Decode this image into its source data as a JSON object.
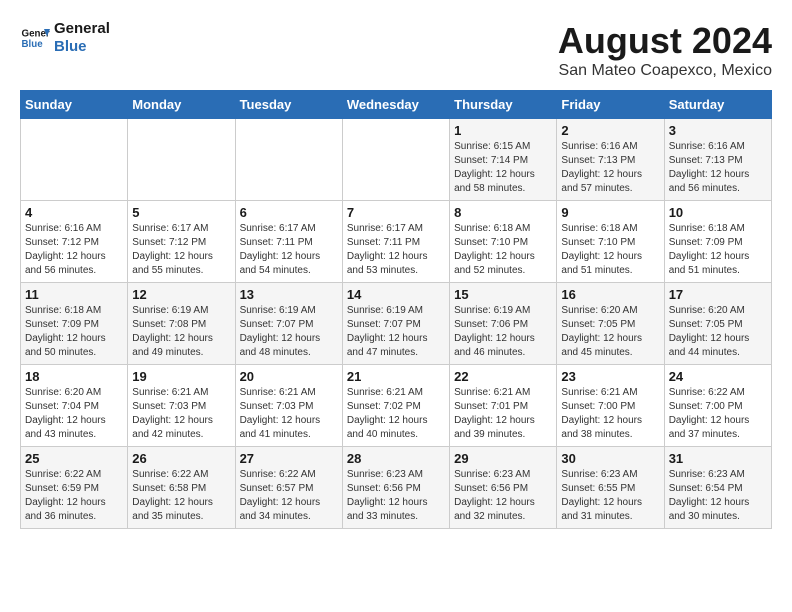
{
  "header": {
    "logo_line1": "General",
    "logo_line2": "Blue",
    "month_title": "August 2024",
    "location": "San Mateo Coapexco, Mexico"
  },
  "weekdays": [
    "Sunday",
    "Monday",
    "Tuesday",
    "Wednesday",
    "Thursday",
    "Friday",
    "Saturday"
  ],
  "weeks": [
    [
      {
        "day": "",
        "info": ""
      },
      {
        "day": "",
        "info": ""
      },
      {
        "day": "",
        "info": ""
      },
      {
        "day": "",
        "info": ""
      },
      {
        "day": "1",
        "info": "Sunrise: 6:15 AM\nSunset: 7:14 PM\nDaylight: 12 hours\nand 58 minutes."
      },
      {
        "day": "2",
        "info": "Sunrise: 6:16 AM\nSunset: 7:13 PM\nDaylight: 12 hours\nand 57 minutes."
      },
      {
        "day": "3",
        "info": "Sunrise: 6:16 AM\nSunset: 7:13 PM\nDaylight: 12 hours\nand 56 minutes."
      }
    ],
    [
      {
        "day": "4",
        "info": "Sunrise: 6:16 AM\nSunset: 7:12 PM\nDaylight: 12 hours\nand 56 minutes."
      },
      {
        "day": "5",
        "info": "Sunrise: 6:17 AM\nSunset: 7:12 PM\nDaylight: 12 hours\nand 55 minutes."
      },
      {
        "day": "6",
        "info": "Sunrise: 6:17 AM\nSunset: 7:11 PM\nDaylight: 12 hours\nand 54 minutes."
      },
      {
        "day": "7",
        "info": "Sunrise: 6:17 AM\nSunset: 7:11 PM\nDaylight: 12 hours\nand 53 minutes."
      },
      {
        "day": "8",
        "info": "Sunrise: 6:18 AM\nSunset: 7:10 PM\nDaylight: 12 hours\nand 52 minutes."
      },
      {
        "day": "9",
        "info": "Sunrise: 6:18 AM\nSunset: 7:10 PM\nDaylight: 12 hours\nand 51 minutes."
      },
      {
        "day": "10",
        "info": "Sunrise: 6:18 AM\nSunset: 7:09 PM\nDaylight: 12 hours\nand 51 minutes."
      }
    ],
    [
      {
        "day": "11",
        "info": "Sunrise: 6:18 AM\nSunset: 7:09 PM\nDaylight: 12 hours\nand 50 minutes."
      },
      {
        "day": "12",
        "info": "Sunrise: 6:19 AM\nSunset: 7:08 PM\nDaylight: 12 hours\nand 49 minutes."
      },
      {
        "day": "13",
        "info": "Sunrise: 6:19 AM\nSunset: 7:07 PM\nDaylight: 12 hours\nand 48 minutes."
      },
      {
        "day": "14",
        "info": "Sunrise: 6:19 AM\nSunset: 7:07 PM\nDaylight: 12 hours\nand 47 minutes."
      },
      {
        "day": "15",
        "info": "Sunrise: 6:19 AM\nSunset: 7:06 PM\nDaylight: 12 hours\nand 46 minutes."
      },
      {
        "day": "16",
        "info": "Sunrise: 6:20 AM\nSunset: 7:05 PM\nDaylight: 12 hours\nand 45 minutes."
      },
      {
        "day": "17",
        "info": "Sunrise: 6:20 AM\nSunset: 7:05 PM\nDaylight: 12 hours\nand 44 minutes."
      }
    ],
    [
      {
        "day": "18",
        "info": "Sunrise: 6:20 AM\nSunset: 7:04 PM\nDaylight: 12 hours\nand 43 minutes."
      },
      {
        "day": "19",
        "info": "Sunrise: 6:21 AM\nSunset: 7:03 PM\nDaylight: 12 hours\nand 42 minutes."
      },
      {
        "day": "20",
        "info": "Sunrise: 6:21 AM\nSunset: 7:03 PM\nDaylight: 12 hours\nand 41 minutes."
      },
      {
        "day": "21",
        "info": "Sunrise: 6:21 AM\nSunset: 7:02 PM\nDaylight: 12 hours\nand 40 minutes."
      },
      {
        "day": "22",
        "info": "Sunrise: 6:21 AM\nSunset: 7:01 PM\nDaylight: 12 hours\nand 39 minutes."
      },
      {
        "day": "23",
        "info": "Sunrise: 6:21 AM\nSunset: 7:00 PM\nDaylight: 12 hours\nand 38 minutes."
      },
      {
        "day": "24",
        "info": "Sunrise: 6:22 AM\nSunset: 7:00 PM\nDaylight: 12 hours\nand 37 minutes."
      }
    ],
    [
      {
        "day": "25",
        "info": "Sunrise: 6:22 AM\nSunset: 6:59 PM\nDaylight: 12 hours\nand 36 minutes."
      },
      {
        "day": "26",
        "info": "Sunrise: 6:22 AM\nSunset: 6:58 PM\nDaylight: 12 hours\nand 35 minutes."
      },
      {
        "day": "27",
        "info": "Sunrise: 6:22 AM\nSunset: 6:57 PM\nDaylight: 12 hours\nand 34 minutes."
      },
      {
        "day": "28",
        "info": "Sunrise: 6:23 AM\nSunset: 6:56 PM\nDaylight: 12 hours\nand 33 minutes."
      },
      {
        "day": "29",
        "info": "Sunrise: 6:23 AM\nSunset: 6:56 PM\nDaylight: 12 hours\nand 32 minutes."
      },
      {
        "day": "30",
        "info": "Sunrise: 6:23 AM\nSunset: 6:55 PM\nDaylight: 12 hours\nand 31 minutes."
      },
      {
        "day": "31",
        "info": "Sunrise: 6:23 AM\nSunset: 6:54 PM\nDaylight: 12 hours\nand 30 minutes."
      }
    ]
  ]
}
